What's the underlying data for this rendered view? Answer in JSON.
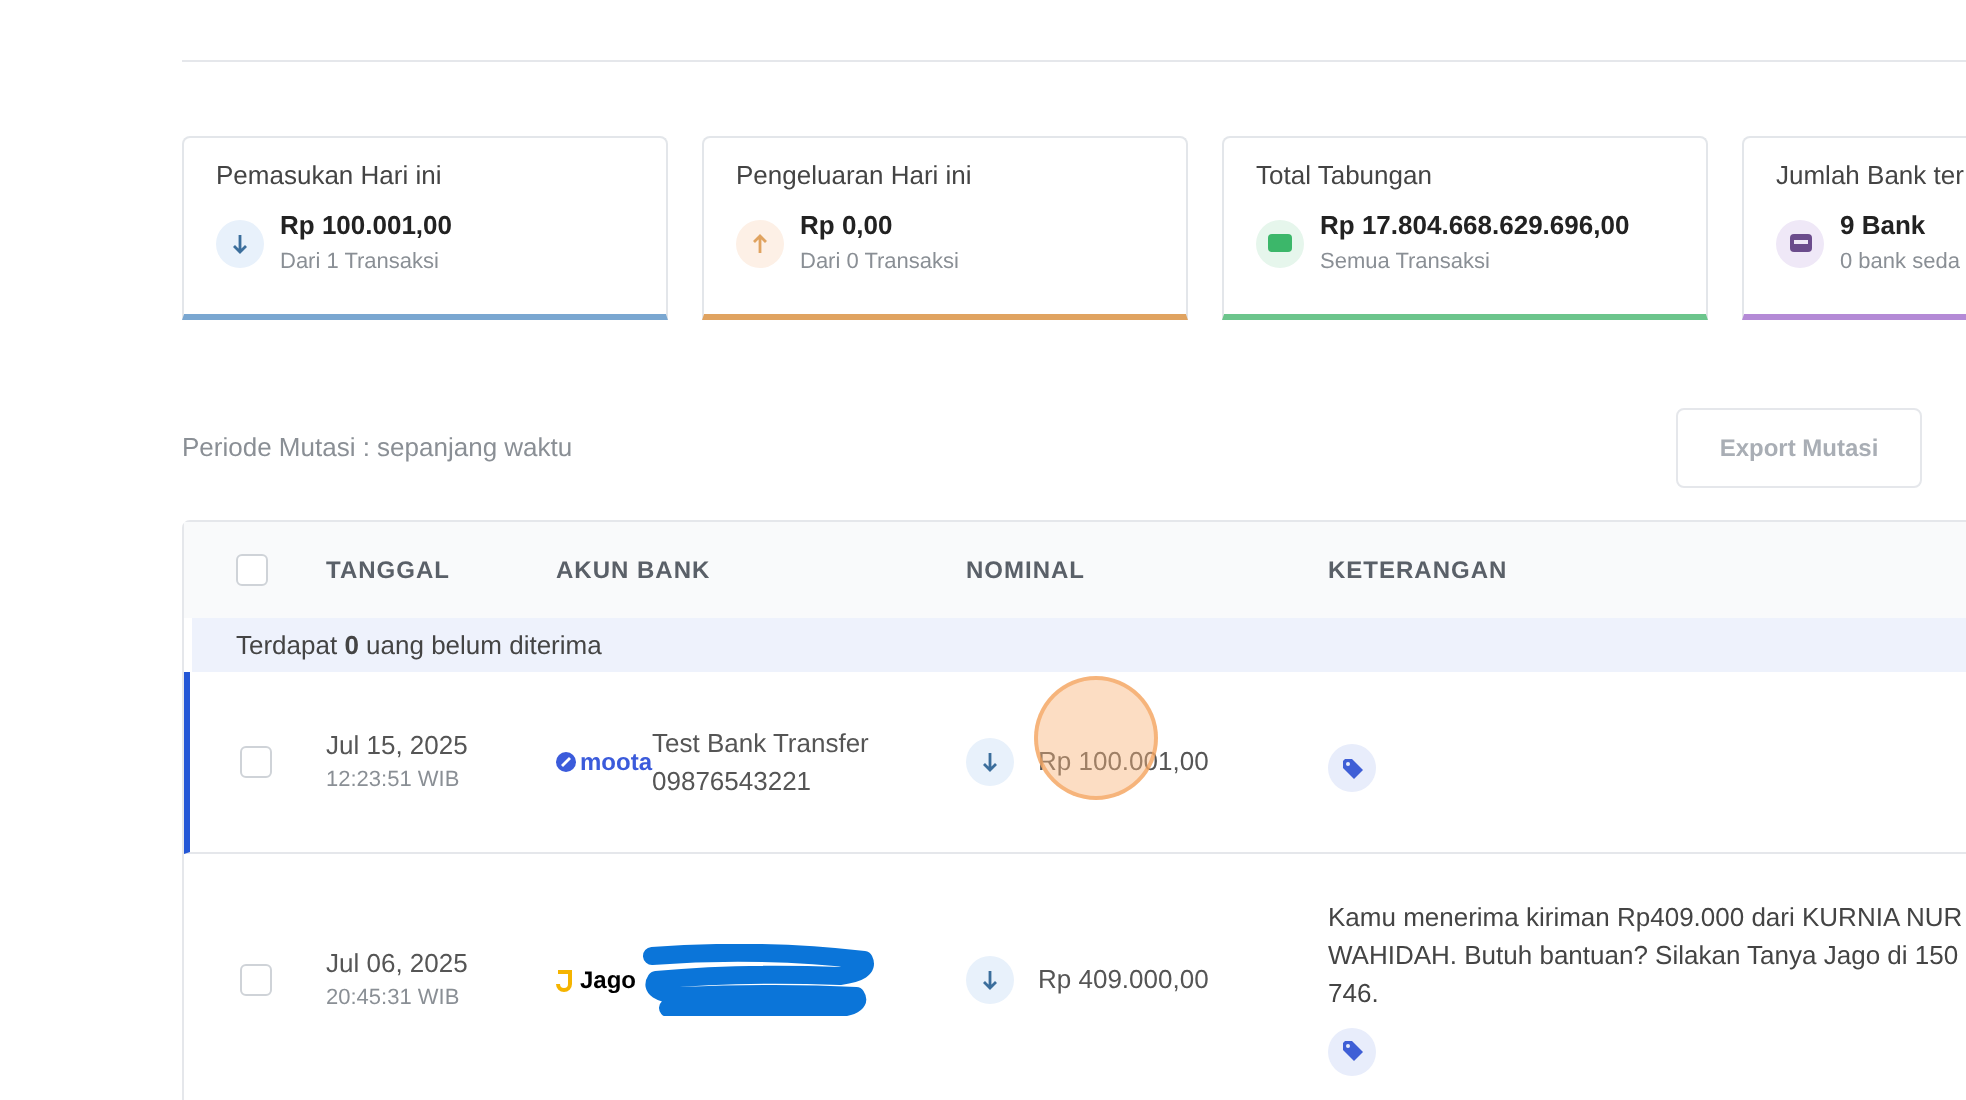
{
  "cards": [
    {
      "kind": "income",
      "title": "Pemasukan Hari ini",
      "amount": "Rp 100.001,00",
      "note": "Dari 1 Transaksi"
    },
    {
      "kind": "expense",
      "title": "Pengeluaran Hari ini",
      "amount": "Rp 0,00",
      "note": "Dari 0 Transaksi"
    },
    {
      "kind": "savings",
      "title": "Total Tabungan",
      "amount": "Rp 17.804.668.629.696,00",
      "note": "Semua Transaksi"
    },
    {
      "kind": "bank",
      "title": "Jumlah Bank ter",
      "amount": "9 Bank",
      "note": "0 bank seda"
    }
  ],
  "period": "Periode Mutasi : sepanjang waktu",
  "export_button": {
    "label": "Export Mutasi",
    "disabled": true
  },
  "table": {
    "columns": [
      "TANGGAL",
      "AKUN BANK",
      "NOMINAL",
      "KETERANGAN"
    ],
    "select_all_checked": false,
    "banner": "Terdapat **0** uang belum diterima",
    "rows": [
      {
        "checked": false,
        "highlighted": true,
        "date": "Jul 15, 2025",
        "time": "12:23:51 WIB",
        "bank_logo": "moota",
        "kind": "moota",
        "account_name": "Test Bank Transfer",
        "account_number": "09876543221",
        "redacted": false,
        "incoming": true,
        "amount": "Rp 100.001,00",
        "click_marker": true
      },
      {
        "checked": false,
        "highlighted": false,
        "date": "Jul 06, 2025",
        "time": "20:45:31 WIB",
        "bank_logo": "Jago",
        "kind": "jago",
        "redacted": true,
        "incoming": true,
        "amount": "Rp 409.000,00",
        "click_marker": false,
        "description": "Kamu menerima kiriman Rp409.000 dari KURNIA NUR WAHIDAH. Butuh bantuan? Silakan Tanya Jago di 150 746."
      }
    ]
  }
}
